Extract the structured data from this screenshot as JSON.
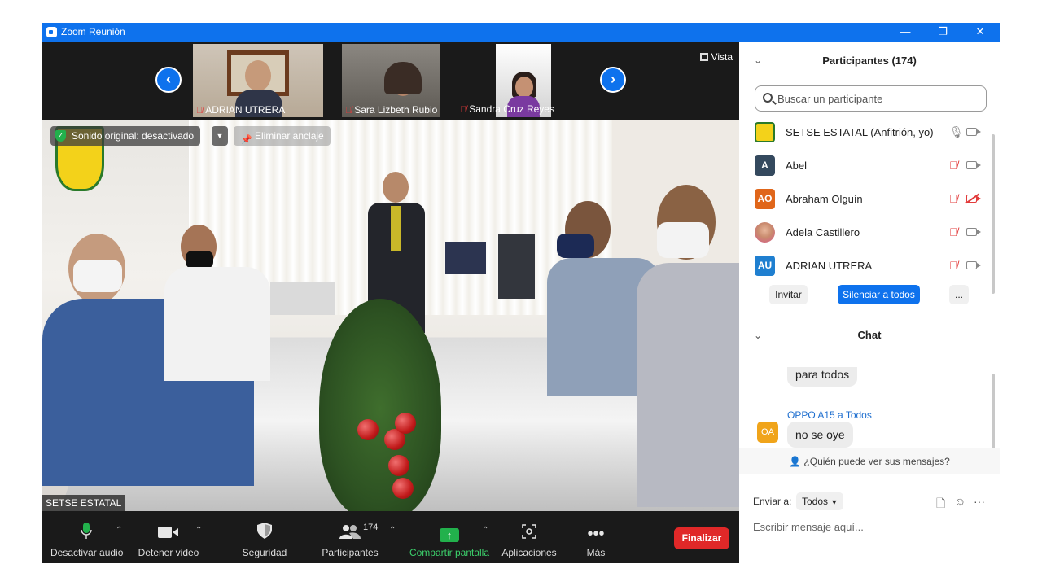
{
  "window": {
    "title": "Zoom Reunión",
    "controls": {
      "minimize": "—",
      "restore": "❐",
      "close": "✕"
    }
  },
  "gallery": {
    "thumbnails": [
      {
        "name": "ADRIAN UTRERA",
        "muted": true
      },
      {
        "name": "Sara Lizbeth Rubio Ji...",
        "muted": true
      },
      {
        "name": "Sandra Cruz Reyes",
        "muted": true
      }
    ],
    "view_label": "Vista"
  },
  "main_video": {
    "sound_status": "Sonido original: desactivado",
    "unpin_label": "Eliminar anclaje",
    "speaker_name": "SETSE ESTATAL"
  },
  "toolbar": {
    "mute_label": "Desactivar audio",
    "stop_video_label": "Detener video",
    "security_label": "Seguridad",
    "participants_label": "Participantes",
    "participants_count": "174",
    "share_label": "Compartir pantalla",
    "apps_label": "Aplicaciones",
    "more_label": "Más",
    "end_label": "Finalizar"
  },
  "participants_panel": {
    "title": "Participantes (174)",
    "search_placeholder": "Buscar un participante",
    "participants": [
      {
        "initials": "",
        "name": "SETSE ESTATAL (Anfitrión, yo)",
        "avatar_color": "#f3d21a",
        "mic_on": true,
        "cam_off": false
      },
      {
        "initials": "A",
        "name": "Abel",
        "avatar_color": "#34495e",
        "mic_on": false,
        "cam_off": false
      },
      {
        "initials": "AO",
        "name": "Abraham Olguín",
        "avatar_color": "#e0661a",
        "mic_on": false,
        "cam_off": true
      },
      {
        "initials": "",
        "name": "Adela Castillero",
        "avatar_color": "#d9a58a",
        "mic_on": false,
        "cam_off": false
      },
      {
        "initials": "AU",
        "name": "ADRIAN UTRERA",
        "avatar_color": "#1f7fd0",
        "mic_on": false,
        "cam_off": false
      }
    ],
    "invite_label": "Invitar",
    "mute_all_label": "Silenciar a todos",
    "more_label": "..."
  },
  "chat_panel": {
    "title": "Chat",
    "messages": [
      {
        "sender": "",
        "text": "para todos"
      },
      {
        "sender": "OPPO A15 a Todos",
        "avatar": "OA",
        "text": "no se oye"
      }
    ],
    "who_can_see": "¿Quién puede ver sus mensajes?",
    "send_to_label": "Enviar a:",
    "send_to_value": "Todos",
    "input_placeholder": "Escribir mensaje aquí..."
  }
}
